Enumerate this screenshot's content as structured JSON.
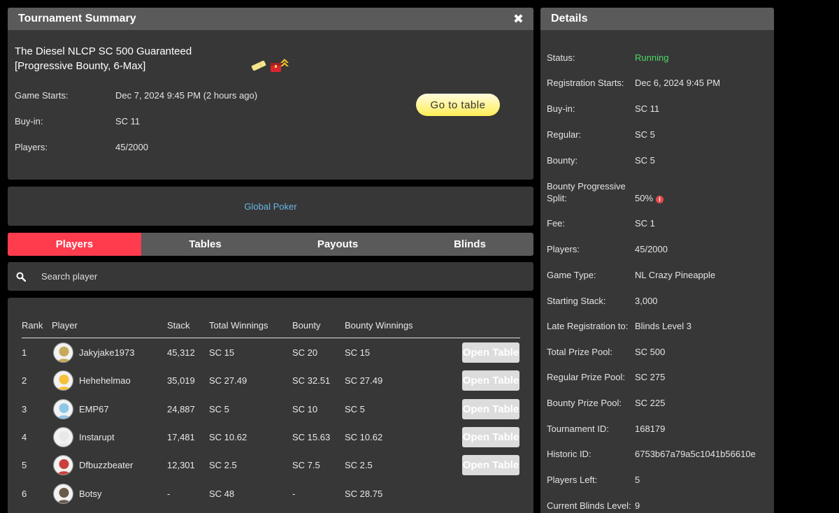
{
  "summary": {
    "header": "Tournament Summary",
    "title_line1": "The Diesel NLCP SC 500 Guaranteed",
    "title_line2": "[Progressive Bounty, 6-Max]",
    "game_starts_label": "Game Starts:",
    "game_starts_value": "Dec 7, 2024 9:45 PM (2 hours ago)",
    "buyin_label": "Buy-in:",
    "buyin_value": "SC 11",
    "players_label": "Players:",
    "players_value": "45/2000",
    "go_button": "Go to table"
  },
  "provider": {
    "link": "Global Poker"
  },
  "tabs": [
    "Players",
    "Tables",
    "Payouts",
    "Blinds"
  ],
  "search": {
    "placeholder": "Search player"
  },
  "table": {
    "headers": {
      "rank": "Rank",
      "player": "Player",
      "stack": "Stack",
      "total_winnings": "Total Winnings",
      "bounty": "Bounty",
      "bounty_winnings": "Bounty Winnings"
    },
    "open_label": "Open Table",
    "rows": [
      {
        "rank": "1",
        "player": "Jakyjake1973",
        "stack": "45,312",
        "total": "SC 15",
        "bounty": "SC 20",
        "bounty_win": "SC 15",
        "open": true,
        "avatar_color": "#c8a85a"
      },
      {
        "rank": "2",
        "player": "Hehehelmao",
        "stack": "35,019",
        "total": "SC 27.49",
        "bounty": "SC 32.51",
        "bounty_win": "SC 27.49",
        "open": true,
        "avatar_color": "#f5c23a"
      },
      {
        "rank": "3",
        "player": "EMP67",
        "stack": "24,887",
        "total": "SC 5",
        "bounty": "SC 10",
        "bounty_win": "SC 5",
        "open": true,
        "avatar_color": "#8fc7e8"
      },
      {
        "rank": "4",
        "player": "Instarupt",
        "stack": "17,481",
        "total": "SC 10.62",
        "bounty": "SC 15.63",
        "bounty_win": "SC 10.62",
        "open": true,
        "avatar_color": "#e8e8e8"
      },
      {
        "rank": "5",
        "player": "Dfbuzzbeater",
        "stack": "12,301",
        "total": "SC 2.5",
        "bounty": "SC 7.5",
        "bounty_win": "SC 2.5",
        "open": true,
        "avatar_color": "#c9413a"
      },
      {
        "rank": "6",
        "player": "Botsy",
        "stack": "-",
        "total": "SC 48",
        "bounty": "-",
        "bounty_win": "SC 28.75",
        "open": false,
        "avatar_color": "#6b5a4a"
      }
    ]
  },
  "details": {
    "header": "Details",
    "rows": [
      {
        "label": "Status:",
        "value": "Running"
      },
      {
        "label": "Registration Starts:",
        "value": "Dec 6, 2024 9:45 PM"
      },
      {
        "label": "Buy-in:",
        "value": "SC 11"
      },
      {
        "label": "Regular:",
        "value": "SC 5"
      },
      {
        "label": "Bounty:",
        "value": "SC 5"
      },
      {
        "label": "Bounty Progressive Split:",
        "value": "50%"
      },
      {
        "label": "Fee:",
        "value": "SC 1"
      },
      {
        "label": "Players:",
        "value": "45/2000"
      },
      {
        "label": "Game Type:",
        "value": "NL Crazy Pineapple"
      },
      {
        "label": "Starting Stack:",
        "value": "3,000"
      },
      {
        "label": "Late Registration to:",
        "value": "Blinds Level 3"
      },
      {
        "label": "Total Prize Pool:",
        "value": "SC 500"
      },
      {
        "label": "Regular Prize Pool:",
        "value": "SC 275"
      },
      {
        "label": "Bounty Prize Pool:",
        "value": "SC 225"
      },
      {
        "label": "Tournament ID:",
        "value": "168179"
      },
      {
        "label": "Historic ID:",
        "value": "6753b67a79a5c1041b56610e"
      },
      {
        "label": "Players Left:",
        "value": "5"
      },
      {
        "label": "Current Blinds Level:",
        "value": "9"
      }
    ]
  },
  "colors": {
    "accent": "#ff3b4e",
    "running": "#4cd964",
    "link": "#6ab7e6",
    "panel": "#373737",
    "header": "#5a5a5a"
  }
}
